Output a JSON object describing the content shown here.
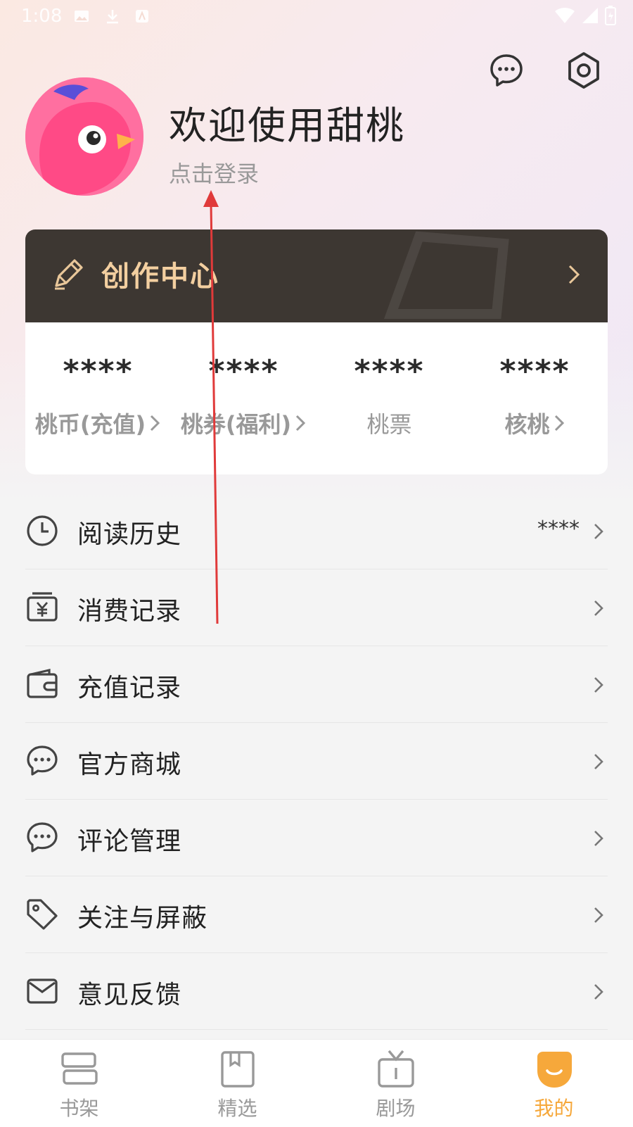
{
  "status_bar": {
    "time": "1:08"
  },
  "header": {
    "welcome": "欢迎使用甜桃",
    "login_hint": "点击登录"
  },
  "creation_center": {
    "title": "创作中心"
  },
  "stats": [
    {
      "value": "****",
      "label": "桃币(充值)",
      "arrow": true,
      "bold": true
    },
    {
      "value": "****",
      "label": "桃券(福利)",
      "arrow": true,
      "bold": true
    },
    {
      "value": "****",
      "label": "桃票",
      "arrow": false,
      "bold": false
    },
    {
      "value": "****",
      "label": "核桃",
      "arrow": true,
      "bold": true
    }
  ],
  "menu": [
    {
      "label": "阅读历史",
      "value": "****",
      "icon": "clock-icon"
    },
    {
      "label": "消费记录",
      "value": "",
      "icon": "yen-receipt-icon"
    },
    {
      "label": "充值记录",
      "value": "",
      "icon": "wallet-icon"
    },
    {
      "label": "官方商城",
      "value": "",
      "icon": "chat-bubble-icon"
    },
    {
      "label": "评论管理",
      "value": "",
      "icon": "comment-icon"
    },
    {
      "label": "关注与屏蔽",
      "value": "",
      "icon": "tag-icon"
    },
    {
      "label": "意见反馈",
      "value": "",
      "icon": "mail-icon"
    }
  ],
  "bottom_nav": [
    {
      "label": "书架",
      "icon": "bookshelf-icon",
      "active": false
    },
    {
      "label": "精选",
      "icon": "book-icon",
      "active": false
    },
    {
      "label": "剧场",
      "icon": "tv-icon",
      "active": false
    },
    {
      "label": "我的",
      "icon": "smile-face-icon",
      "active": true
    }
  ],
  "colors": {
    "accent": "#f6a83b",
    "creation_bg": "#3d3732",
    "creation_text": "#f3cfa0",
    "annotation": "#e03a3a"
  }
}
